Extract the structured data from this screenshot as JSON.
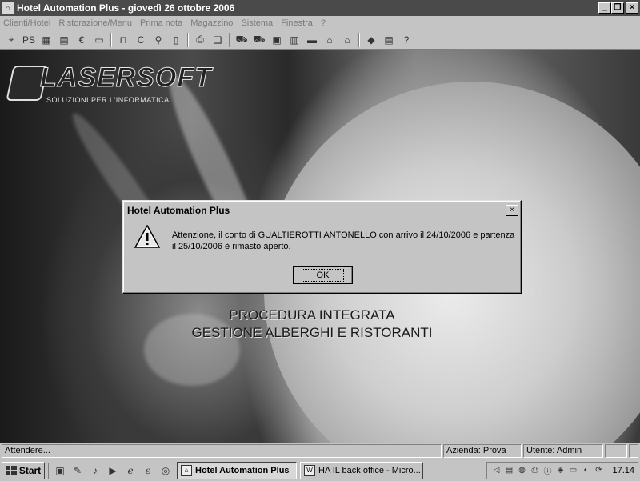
{
  "window": {
    "title": "Hotel Automation Plus - giovedì 26 ottobre 2006",
    "buttons": {
      "minimize": "_",
      "maximize": "❐",
      "close": "×"
    }
  },
  "menu": [
    {
      "label": "Clienti/Hotel"
    },
    {
      "label": "Ristorazione/Menu"
    },
    {
      "label": "Prima nota"
    },
    {
      "label": "Magazzino"
    },
    {
      "label": "Sistema"
    },
    {
      "label": "Finestra"
    },
    {
      "label": "?"
    }
  ],
  "toolbar": [
    {
      "icon": "pin-icon",
      "glyph": "⌖"
    },
    {
      "icon": "ps-icon",
      "glyph": "PS"
    },
    {
      "icon": "grid-icon",
      "glyph": "▦"
    },
    {
      "icon": "calendar-icon",
      "glyph": "▤"
    },
    {
      "icon": "euro-icon",
      "glyph": "€"
    },
    {
      "icon": "card-icon",
      "glyph": "▭"
    },
    {
      "icon": "bed-icon",
      "glyph": "⊓"
    },
    {
      "icon": "c-icon",
      "glyph": "C"
    },
    {
      "icon": "user-search-icon",
      "glyph": "⚲"
    },
    {
      "icon": "document-icon",
      "glyph": "▯"
    },
    {
      "icon": "printer-icon",
      "glyph": "⎙"
    },
    {
      "icon": "documents-icon",
      "glyph": "❏"
    },
    {
      "icon": "truck-icon",
      "glyph": "⛟"
    },
    {
      "icon": "truck-return-icon",
      "glyph": "⛟"
    },
    {
      "icon": "report-icon",
      "glyph": "▣"
    },
    {
      "icon": "number-icon",
      "glyph": "▥"
    },
    {
      "icon": "cash-register-icon",
      "glyph": "▬"
    },
    {
      "icon": "store-icon",
      "glyph": "⌂"
    },
    {
      "icon": "warehouse-icon",
      "glyph": "⌂"
    },
    {
      "icon": "tag-icon",
      "glyph": "◆"
    },
    {
      "icon": "calculator-icon",
      "glyph": "▤"
    },
    {
      "icon": "help-icon",
      "glyph": "?"
    }
  ],
  "background": {
    "logo_text": "LASERSOFT",
    "logo_subtitle": "SOLUZIONI PER L'INFORMATICA",
    "tagline_line1": "PROCEDURA INTEGRATA",
    "tagline_line2": "GESTIONE ALBERGHI E RISTORANTI"
  },
  "dialog": {
    "title": "Hotel Automation Plus",
    "message": "Attenzione, il conto di GUALTIEROTTI ANTONELLO con arrivo il 24/10/2006 e partenza il 25/10/2006 è rimasto aperto.",
    "ok_label": "OK",
    "close_glyph": "×"
  },
  "statusbar": {
    "status": "Attendere...",
    "azienda": "Azienda: Prova",
    "utente": "Utente: Admin"
  },
  "taskbar": {
    "start_label": "Start",
    "quick_launch": [
      "desktop-icon",
      "edit-icon",
      "media-icon",
      "play-icon",
      "ie-icon",
      "ie2-icon",
      "outlook-icon"
    ],
    "tasks": [
      {
        "label": "Hotel Automation Plus",
        "active": true
      },
      {
        "label": "HA IL back office - Micro...",
        "active": false
      }
    ],
    "tray_icons": [
      "speaker-icon",
      "network-icon",
      "globe-icon",
      "printer-icon",
      "info-icon",
      "shield-icon",
      "display-icon",
      "antivirus-icon",
      "sync-icon"
    ],
    "clock": "17.14"
  }
}
